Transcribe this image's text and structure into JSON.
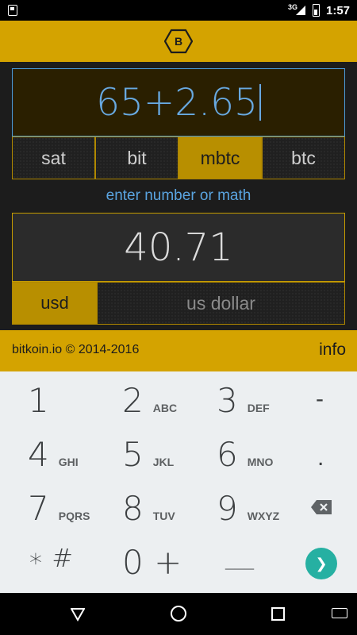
{
  "status": {
    "network": "3G",
    "time": "1:57"
  },
  "input": {
    "value": "65+2.65"
  },
  "units": [
    {
      "label": "sat",
      "active": false
    },
    {
      "label": "bit",
      "active": false
    },
    {
      "label": "mbtc",
      "active": true
    },
    {
      "label": "btc",
      "active": false
    }
  ],
  "hint": "enter number or math",
  "output": {
    "value": "40.71"
  },
  "currency": {
    "code": "usd",
    "name": "us dollar"
  },
  "footer": {
    "copyright": "bitkoin.io © 2014-2016",
    "info": "info"
  },
  "keyboard": {
    "k1": {
      "num": "1",
      "letters": ""
    },
    "k2": {
      "num": "2",
      "letters": "ABC"
    },
    "k3": {
      "num": "3",
      "letters": "DEF"
    },
    "k4": {
      "num": "4",
      "letters": "GHI"
    },
    "k5": {
      "num": "5",
      "letters": "JKL"
    },
    "k6": {
      "num": "6",
      "letters": "MNO"
    },
    "k7": {
      "num": "7",
      "letters": "PQRS"
    },
    "k8": {
      "num": "8",
      "letters": "TUV"
    },
    "k9": {
      "num": "9",
      "letters": "WXYZ"
    },
    "kstar": {
      "num": "∗ #"
    },
    "k0": {
      "num": "0 +"
    },
    "kspace": {
      "num": "___"
    },
    "minus": "-",
    "dot": "."
  },
  "colors": {
    "accent": "#d4a300",
    "active_unit": "#b88f00",
    "hint": "#5aa4e0",
    "enter": "#26b0a2"
  }
}
